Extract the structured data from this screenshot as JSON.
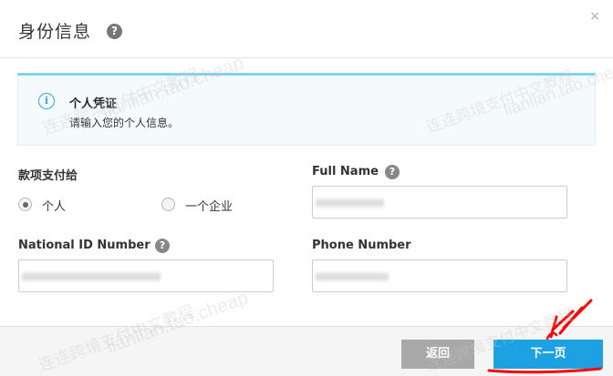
{
  "header": {
    "title": "身份信息",
    "help_glyph": "?",
    "close_glyph": "×"
  },
  "notice": {
    "title": "个人凭证",
    "description": "请输入您的个人信息。"
  },
  "form": {
    "payment_to_label": "款项支付给",
    "options": [
      {
        "label": "个人",
        "checked": true
      },
      {
        "label": "一个企业",
        "checked": false
      }
    ],
    "full_name_label": "Full Name",
    "national_id_label": "National ID Number",
    "phone_label": "Phone Number"
  },
  "footer": {
    "back_label": "返回",
    "next_label": "下一页"
  },
  "colors": {
    "primary": "#1da1e2",
    "secondary_button": "#a8a8a8",
    "notice_accent": "#7dd3ec",
    "annotation": "#ff0000"
  },
  "watermark": {
    "lines": [
      "连连跨境支付中文教程",
      "lianlian.tao.cheap"
    ]
  }
}
